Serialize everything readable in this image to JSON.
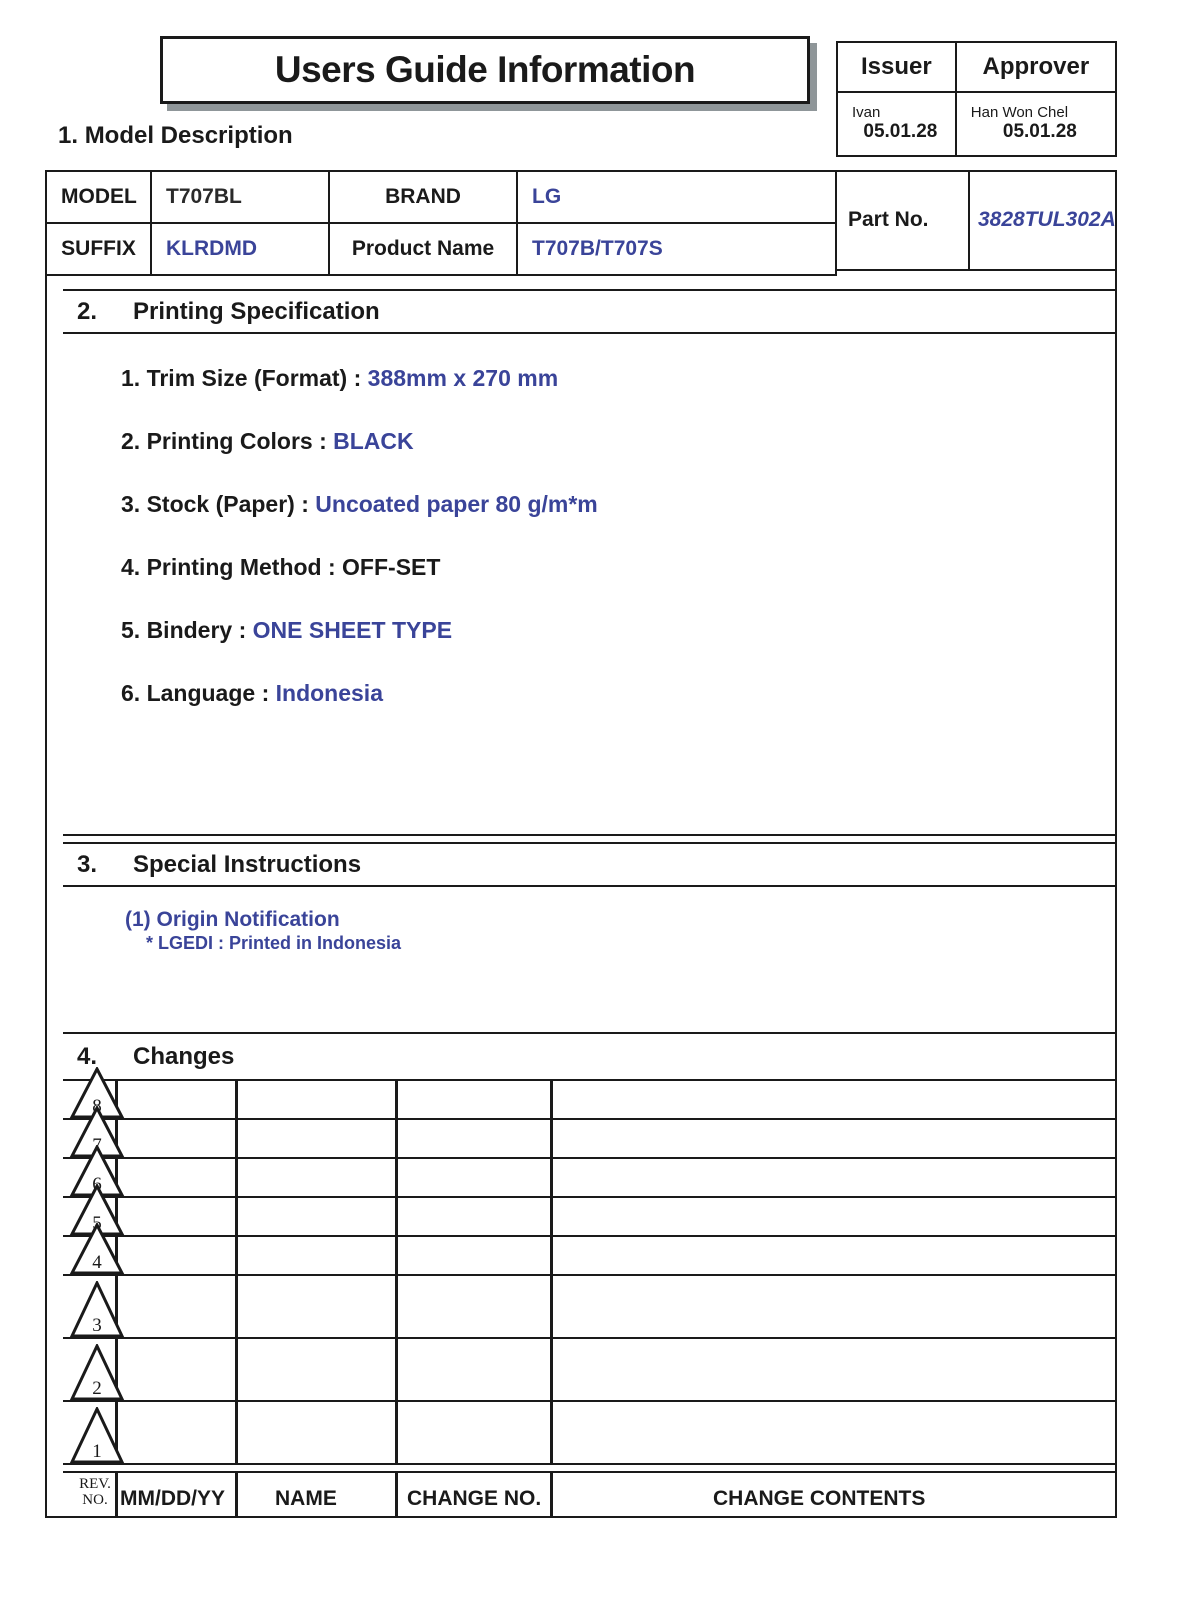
{
  "document": {
    "title": "Users Guide Information"
  },
  "approval": {
    "headers": [
      "Issuer",
      "Approver"
    ],
    "issuer": {
      "name": "Ivan",
      "date": "05.01.28"
    },
    "approver": {
      "name": "Han Won Chel",
      "date": "05.01.28"
    }
  },
  "sections": {
    "model_description": {
      "number": "1.",
      "title": "Model Description"
    },
    "printing_specification": {
      "number": "2.",
      "title": "Printing Specification"
    },
    "special_instructions": {
      "number": "3.",
      "title": "Special Instructions"
    },
    "changes": {
      "number": "4.",
      "title": "Changes"
    }
  },
  "model_table": {
    "model_label": "MODEL",
    "model_value": "T707BL",
    "brand_label": "BRAND",
    "brand_value": "LG",
    "suffix_label": "SUFFIX",
    "suffix_value": "KLRDMD",
    "product_name_label": "Product  Name",
    "product_name_value": "T707B/T707S",
    "part_no_label": "Part No.",
    "part_no_value": "3828TUL302A"
  },
  "printing_spec_items": [
    {
      "label": "1. Trim Size (Format) : ",
      "value": "388mm x 270 mm",
      "value_color": "blue"
    },
    {
      "label": "2. Printing Colors : ",
      "value": "BLACK",
      "value_color": "blue"
    },
    {
      "label": "3. Stock (Paper) : ",
      "value": "Uncoated paper 80 g/m*m",
      "value_color": "blue"
    },
    {
      "label": "4. Printing Method : ",
      "value": "OFF-SET",
      "value_color": "black"
    },
    {
      "label": "5. Bindery  : ",
      "value": "ONE SHEET TYPE",
      "value_color": "blue"
    },
    {
      "label": "6. Language : ",
      "value": "Indonesia",
      "value_color": "blue"
    }
  ],
  "special_instructions_lines": [
    "(1) Origin Notification",
    "* LGEDI : Printed in Indonesia"
  ],
  "changes_table": {
    "revision_numbers": [
      "8",
      "7",
      "6",
      "5",
      "4",
      "3",
      "2",
      "1"
    ],
    "footer_headers": {
      "rev_no_line1": "REV.",
      "rev_no_line2": "NO.",
      "date": "MM/DD/YY",
      "name": "NAME",
      "change_no": "CHANGE NO.",
      "change_contents": "CHANGE   CONTENTS"
    },
    "rows": [
      {
        "rev": "8",
        "date": "",
        "name": "",
        "change_no": "",
        "contents": ""
      },
      {
        "rev": "7",
        "date": "",
        "name": "",
        "change_no": "",
        "contents": ""
      },
      {
        "rev": "6",
        "date": "",
        "name": "",
        "change_no": "",
        "contents": ""
      },
      {
        "rev": "5",
        "date": "",
        "name": "",
        "change_no": "",
        "contents": ""
      },
      {
        "rev": "4",
        "date": "",
        "name": "",
        "change_no": "",
        "contents": ""
      },
      {
        "rev": "3",
        "date": "",
        "name": "",
        "change_no": "",
        "contents": ""
      },
      {
        "rev": "2",
        "date": "",
        "name": "",
        "change_no": "",
        "contents": ""
      },
      {
        "rev": "1",
        "date": "",
        "name": "",
        "change_no": "",
        "contents": ""
      }
    ]
  },
  "colors": {
    "accent_blue": "#3a4499",
    "ink_black": "#1a1a1a",
    "shadow_gray": "#8f9699"
  }
}
